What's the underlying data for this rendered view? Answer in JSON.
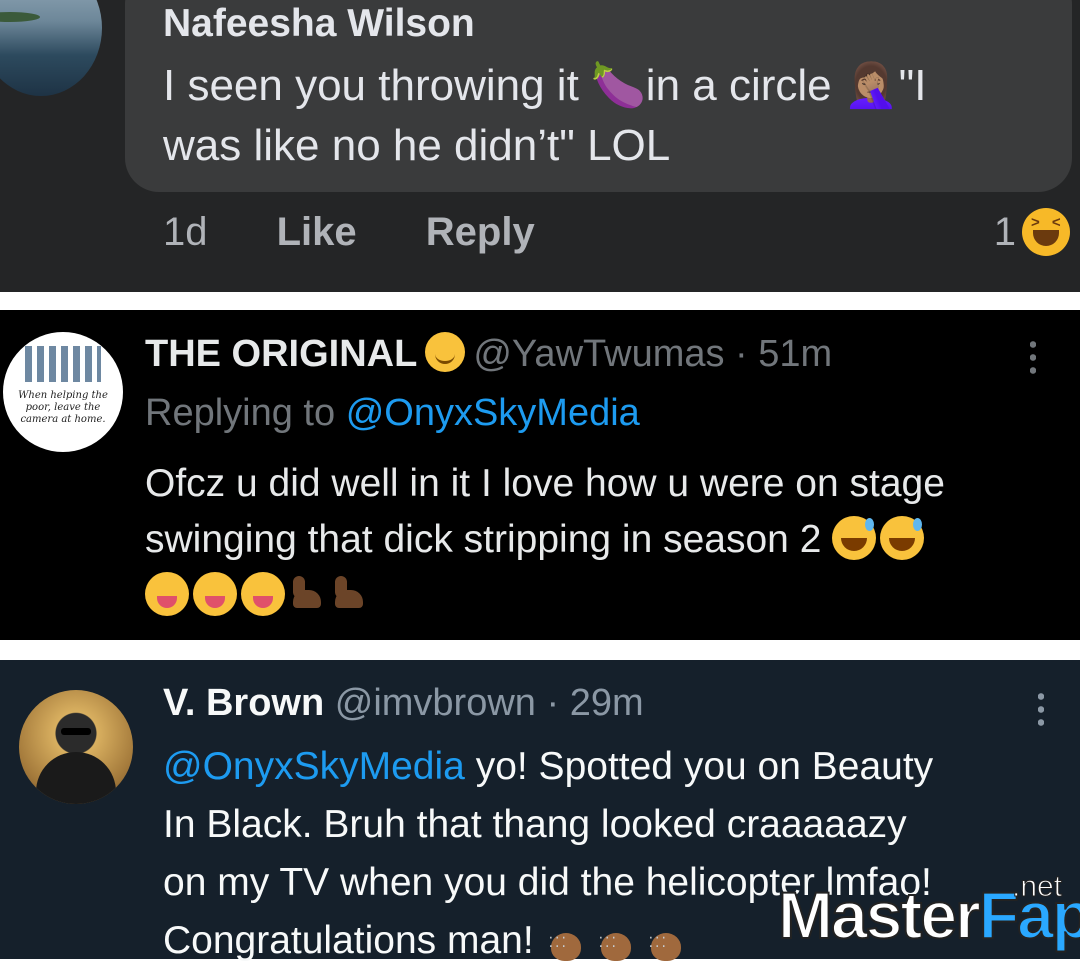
{
  "comment_fb": {
    "author": "Nafeesha Wilson",
    "text_line1": "I seen you throwing it 🍆in a circle 🤦🏽‍♀️\"I",
    "text_line2": "was like no he didn’t\" LOL",
    "time": "1d",
    "like_label": "Like",
    "reply_label": "Reply",
    "reaction_count": "1"
  },
  "tweet_original": {
    "display_name": "THE ORIGINAL",
    "handle": "@YawTwumas",
    "time": "· 51m",
    "replying_to_label": "Replying to",
    "replying_to_handle": "@OnyxSkyMedia",
    "text_line1": "Ofcz u did well in it I love how u were on stage",
    "text_line2": "swinging that dick stripping in season 2",
    "avatar_caption": "When helping the poor, leave the camera at home."
  },
  "tweet_vbrown": {
    "display_name": "V. Brown",
    "handle": "@imvbrown",
    "time": "· 29m",
    "mention": "@OnyxSkyMedia",
    "text_after_mention": " yo! Spotted you on Beauty",
    "text_line2": "In Black. Bruh that thang looked craaaaazy",
    "text_line3": "on my TV when you did the helicopter lmfao!",
    "text_line4": "Congratulations man!"
  },
  "watermark": {
    "part1": "Master",
    "part2": "Fap",
    "suffix": ".net"
  }
}
